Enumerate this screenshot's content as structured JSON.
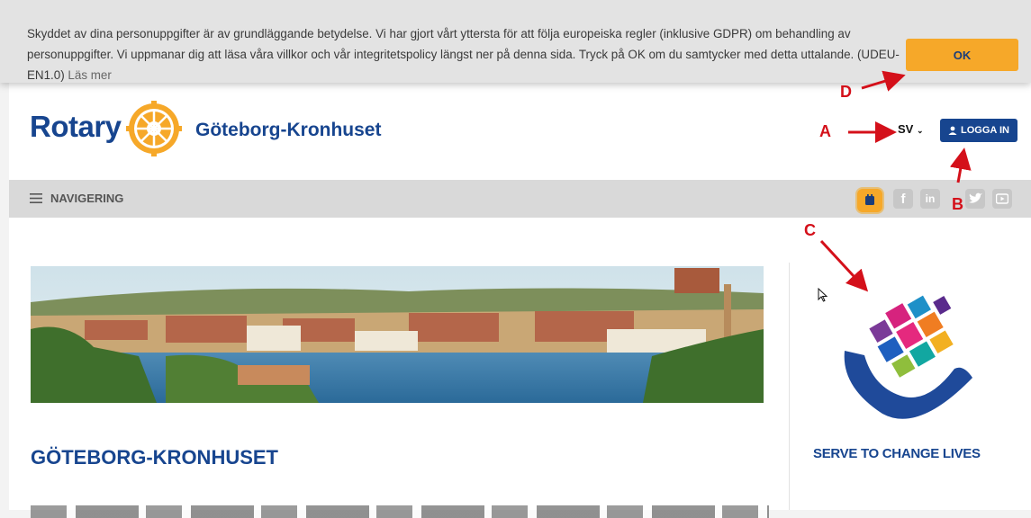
{
  "cookie_banner": {
    "text": "Skyddet av dina personuppgifter är av grundläggande betydelse. Vi har gjort vårt yttersta för att följa europeiska regler (inklusive GDPR) om behandling av personuppgifter. Vi uppmanar dig att läsa våra villkor och vår integritetspolicy längst ner på denna sida. Tryck på OK om du samtycker med detta uttalande. (UDEU-EN1.0)",
    "more_link": "Läs mer",
    "ok_label": "OK"
  },
  "header": {
    "logo_text": "Rotary",
    "club_name": "Göteborg-Kronhuset",
    "language": "SV",
    "login_label": "LOGGA IN"
  },
  "nav": {
    "toggle_label": "NAVIGERING",
    "icons": [
      "calendar-icon",
      "facebook-icon",
      "linkedin-icon",
      "twitter-icon",
      "youtube-icon"
    ]
  },
  "main": {
    "title": "GÖTEBORG-KRONHUSET"
  },
  "sidebar": {
    "slogan": "SERVE TO CHANGE LIVES"
  },
  "annotations": {
    "a": "A",
    "b": "B",
    "c": "C",
    "d": "D"
  },
  "colors": {
    "rotary_blue": "#17458f",
    "rotary_gold": "#f6a829",
    "annotation_red": "#d4101a"
  }
}
